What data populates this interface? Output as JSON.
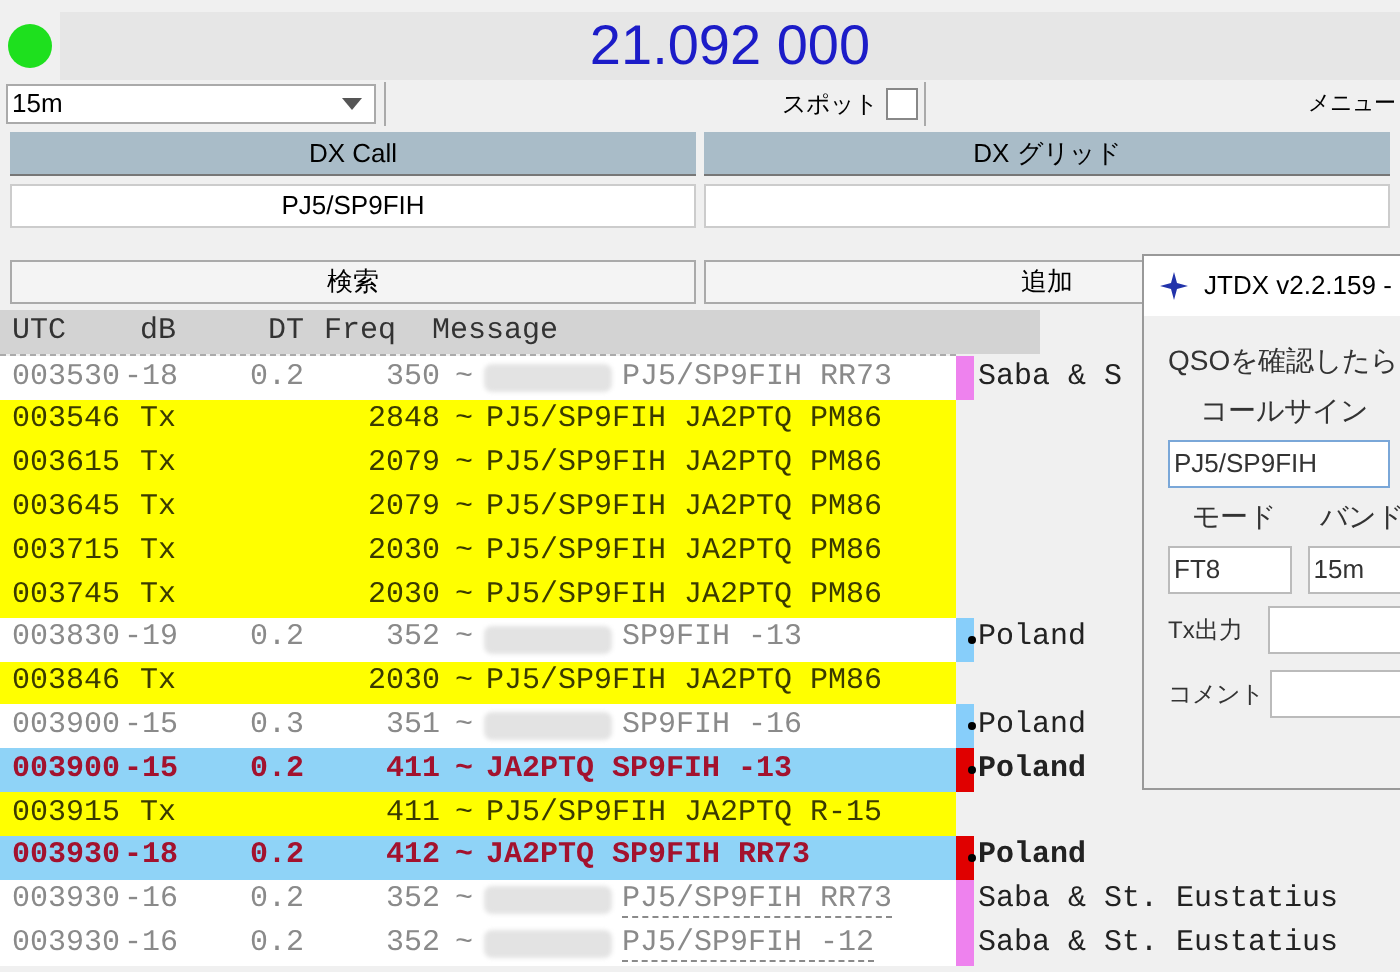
{
  "status_light": {
    "on": true
  },
  "frequency": "21.092 000",
  "band": {
    "value": "15m"
  },
  "spot": {
    "label": "スポット",
    "checked": false
  },
  "menu": {
    "label": "メニュー"
  },
  "dx_call": {
    "header": "DX Call",
    "value": "PJ5/SP9FIH"
  },
  "dx_grid": {
    "header": "DX グリッド"
  },
  "buttons": [
    "検索",
    "追加"
  ],
  "table": {
    "columns": [
      "UTC",
      "dB",
      "DT",
      "Freq",
      "Message"
    ],
    "rows": [
      {
        "kind": "rx",
        "utc": "003530",
        "db": "-18",
        "dt": "0.2",
        "freq": "350",
        "sep": "~",
        "redacted": true,
        "message": "PJ5/SP9FIH RR73",
        "dashed": false,
        "marker": {
          "color": "#ee82ee",
          "dot": false
        },
        "country": "Saba & S"
      },
      {
        "kind": "tx",
        "utc": "003546",
        "db": "Tx",
        "freq": "2848",
        "sep": "~",
        "redacted": false,
        "message": "PJ5/SP9FIH JA2PTQ PM86",
        "dashed": false
      },
      {
        "kind": "tx",
        "utc": "003615",
        "db": "Tx",
        "freq": "2079",
        "sep": "~",
        "redacted": false,
        "message": "PJ5/SP9FIH JA2PTQ PM86",
        "dashed": false
      },
      {
        "kind": "tx",
        "utc": "003645",
        "db": "Tx",
        "freq": "2079",
        "sep": "~",
        "redacted": false,
        "message": "PJ5/SP9FIH JA2PTQ PM86",
        "dashed": false
      },
      {
        "kind": "tx",
        "utc": "003715",
        "db": "Tx",
        "freq": "2030",
        "sep": "~",
        "redacted": false,
        "message": "PJ5/SP9FIH JA2PTQ PM86",
        "dashed": false
      },
      {
        "kind": "tx",
        "utc": "003745",
        "db": "Tx",
        "freq": "2030",
        "sep": "~",
        "redacted": false,
        "message": "PJ5/SP9FIH JA2PTQ PM86",
        "dashed": false
      },
      {
        "kind": "rx",
        "utc": "003830",
        "db": "-19",
        "dt": "0.2",
        "freq": "352",
        "sep": "~",
        "redacted": true,
        "message": "SP9FIH -13",
        "dashed": false,
        "marker": {
          "color": "#87cefa",
          "dot": true
        },
        "country": "Poland"
      },
      {
        "kind": "tx",
        "utc": "003846",
        "db": "Tx",
        "freq": "2030",
        "sep": "~",
        "redacted": false,
        "message": "PJ5/SP9FIH JA2PTQ PM86",
        "dashed": false
      },
      {
        "kind": "rx",
        "utc": "003900",
        "db": "-15",
        "dt": "0.3",
        "freq": "351",
        "sep": "~",
        "redacted": true,
        "message": "SP9FIH -16",
        "dashed": false,
        "marker": {
          "color": "#87cefa",
          "dot": true
        },
        "country": "Poland"
      },
      {
        "kind": "mine",
        "utc": "003900",
        "db": "-15",
        "dt": "0.2",
        "freq": "411",
        "sep": "~",
        "redacted": false,
        "message": "JA2PTQ SP9FIH -13",
        "dashed": false,
        "marker": {
          "color": "#e00000",
          "dot": true
        },
        "country": "Poland"
      },
      {
        "kind": "tx",
        "utc": "003915",
        "db": "Tx",
        "freq": "411",
        "sep": "~",
        "redacted": false,
        "message": "PJ5/SP9FIH JA2PTQ R-15",
        "dashed": false
      },
      {
        "kind": "mine",
        "utc": "003930",
        "db": "-18",
        "dt": "0.2",
        "freq": "412",
        "sep": "~",
        "redacted": false,
        "message": "JA2PTQ SP9FIH RR73",
        "dashed": false,
        "marker": {
          "color": "#e00000",
          "dot": true
        },
        "country": "Poland"
      },
      {
        "kind": "rx",
        "utc": "003930",
        "db": "-16",
        "dt": "0.2",
        "freq": "352",
        "sep": "~",
        "redacted": true,
        "message": "PJ5/SP9FIH RR73",
        "dashed": true,
        "marker": {
          "color": "#ee82ee",
          "dot": false
        },
        "country": "Saba & St. Eustatius"
      },
      {
        "kind": "rx",
        "utc": "003930",
        "db": "-16",
        "dt": "0.2",
        "freq": "352",
        "sep": "~",
        "redacted": true,
        "message": "PJ5/SP9FIH -12",
        "dashed": true,
        "marker": {
          "color": "#ee82ee",
          "dot": false
        },
        "country": "Saba & St. Eustatius"
      }
    ]
  },
  "dialog": {
    "title": "JTDX v2.2.159 -",
    "prompt": "QSOを確認したら",
    "callsign_label": "コールサイン",
    "callsign": "PJ5/SP9FIH",
    "mode_label": "モード",
    "band_label": "バンド",
    "mode": "FT8",
    "band": "15m",
    "tx_power_label": "Tx出力",
    "comment_label": "コメント"
  }
}
